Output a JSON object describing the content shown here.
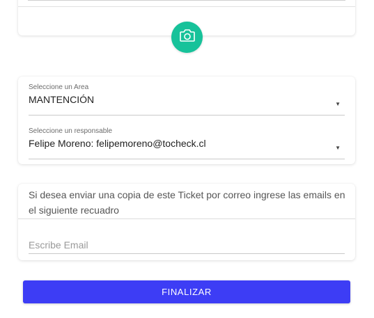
{
  "photo": {
    "camera_icon": "camera-icon",
    "accent_color": "#17c29a"
  },
  "area": {
    "label": "Seleccione un Area",
    "value": "MANTENCIÓN"
  },
  "responsable": {
    "label": "Seleccione un responsable",
    "value": "Felipe Moreno: felipemoreno@tocheck.cl"
  },
  "email": {
    "info": "Si desea enviar una copia de este Ticket por correo ingrese las emails en el siguiente recuadro",
    "placeholder": "Escribe Email",
    "value": ""
  },
  "actions": {
    "finalize_label": "FINALIZAR",
    "button_color": "#3d3df5"
  }
}
